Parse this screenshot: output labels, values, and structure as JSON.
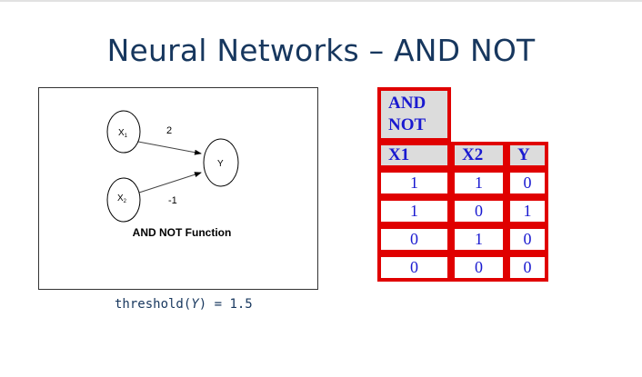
{
  "slide": {
    "title": "Neural Networks – AND NOT"
  },
  "diagram": {
    "nodes": {
      "x1": {
        "label": "X",
        "sub": "1"
      },
      "x2": {
        "label": "X",
        "sub": "2"
      },
      "y": {
        "label": "Y"
      }
    },
    "weights": {
      "x1_to_y": "2",
      "x2_to_y": "-1"
    },
    "caption": "AND NOT Function"
  },
  "threshold": {
    "prefix": "threshold(",
    "var": "Y",
    "suffix": ") = 1.5"
  },
  "table": {
    "title_line1": "AND",
    "title_line2": "NOT",
    "headers": [
      "X1",
      "X2",
      "Y"
    ],
    "rows": [
      [
        "1",
        "1",
        "0"
      ],
      [
        "1",
        "0",
        "1"
      ],
      [
        "0",
        "1",
        "0"
      ],
      [
        "0",
        "0",
        "0"
      ]
    ]
  }
}
